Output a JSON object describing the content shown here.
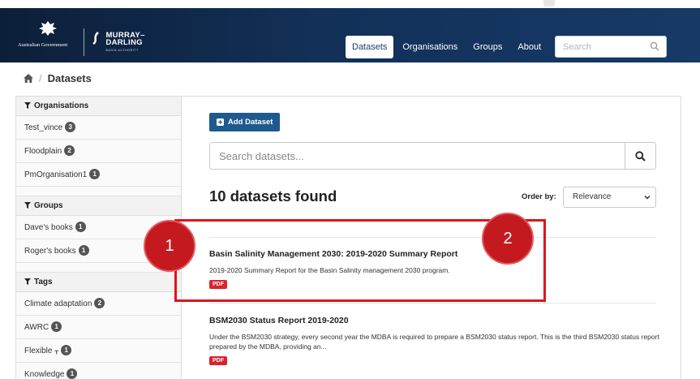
{
  "header": {
    "gov_logo_text": "Australian Government",
    "mdba_line1": "MURRAY–",
    "mdba_line2": "DARLING",
    "mdba_sub": "BASIN AUTHORITY",
    "nav": [
      {
        "label": "Datasets",
        "active": true
      },
      {
        "label": "Organisations",
        "active": false
      },
      {
        "label": "Groups",
        "active": false
      },
      {
        "label": "About",
        "active": false
      }
    ],
    "search_placeholder": "Search"
  },
  "breadcrumb": {
    "separator": "/",
    "current": "Datasets"
  },
  "sidebar": {
    "organisations_heading": "Organisations",
    "organisations": [
      {
        "label": "Test_vince",
        "count": "3"
      },
      {
        "label": "Floodplain",
        "count": "2"
      },
      {
        "label": "PmOrganisation1",
        "count": "1"
      }
    ],
    "groups_heading": "Groups",
    "groups": [
      {
        "label": "Dave's books",
        "count": "1"
      },
      {
        "label": "Roger's books",
        "count": "1"
      }
    ],
    "tags_heading": "Tags",
    "tags": [
      {
        "label": "Climate adaptation",
        "count": "2"
      },
      {
        "label": "AWRC",
        "count": "1"
      },
      {
        "label": "Flexible ᚁ",
        "count": "1"
      },
      {
        "label": "Knowledge",
        "count": "1"
      }
    ]
  },
  "main": {
    "add_dataset_label": "Add Dataset",
    "search_placeholder": "Search datasets...",
    "found_text": "10 datasets found",
    "order_by_label": "Order by:",
    "order_by_value": "Relevance",
    "datasets": [
      {
        "title": "Basin Salinity Management 2030: 2019-2020 Summary Report",
        "description": "2019-2020 Summary Report for the Basin Salinity management 2030 program.",
        "format": "PDF"
      },
      {
        "title": "BSM2030 Status Report 2019-2020",
        "description": "Under the BSM2030 strategy, every second year the MDBA is required to prepare a BSM2030 status report. This is the third BSM2030 status report prepared by the MDBA, providing an...",
        "format": "PDF"
      }
    ]
  },
  "annotations": {
    "marker_1": "1",
    "marker_2": "2",
    "highlight_color": "#e1131b"
  },
  "colors": {
    "header_bg": "#123058",
    "primary_button": "#1f5a8f",
    "pdf_badge": "#d9232e",
    "marker": "#c41a1f"
  }
}
